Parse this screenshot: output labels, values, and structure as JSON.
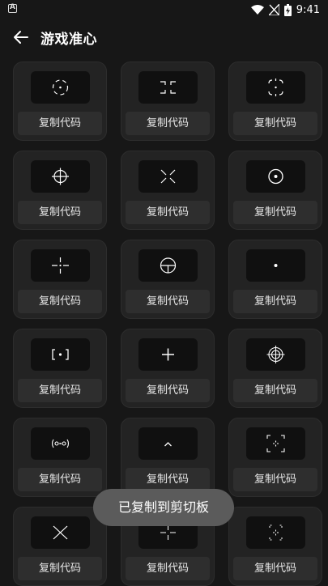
{
  "status_bar": {
    "time": "9:41",
    "notification_icon": "a-icon",
    "icons": [
      "wifi-icon",
      "signal-icon",
      "battery-charging-icon"
    ]
  },
  "app_bar": {
    "title": "游戏准心",
    "back_icon": "arrow-left-icon"
  },
  "crosshairs": [
    {
      "icon": "crosshair-dotted-ring-icon",
      "button_label": "复制代码"
    },
    {
      "icon": "crosshair-corners-inward-icon",
      "button_label": "复制代码"
    },
    {
      "icon": "crosshair-brackets-ring-icon",
      "button_label": "复制代码"
    },
    {
      "icon": "crosshair-scope-ring-icon",
      "button_label": "复制代码"
    },
    {
      "icon": "crosshair-x-gap-icon",
      "button_label": "复制代码"
    },
    {
      "icon": "crosshair-circle-dot-icon",
      "button_label": "复制代码"
    },
    {
      "icon": "crosshair-plus-gap-dot-icon",
      "button_label": "复制代码"
    },
    {
      "icon": "crosshair-circle-t-icon",
      "button_label": "复制代码"
    },
    {
      "icon": "crosshair-single-dot-icon",
      "button_label": "复制代码"
    },
    {
      "icon": "crosshair-brackets-dot-icon",
      "button_label": "复制代码"
    },
    {
      "icon": "crosshair-plus-icon",
      "button_label": "复制代码"
    },
    {
      "icon": "crosshair-target-circle-icon",
      "button_label": "复制代码"
    },
    {
      "icon": "crosshair-ornate-icon",
      "button_label": "复制代码"
    },
    {
      "icon": "crosshair-chevron-icon",
      "button_label": "复制代码"
    },
    {
      "icon": "crosshair-square-corners-icon",
      "button_label": "复制代码"
    },
    {
      "icon": "crosshair-x-icon",
      "button_label": "复制代码"
    },
    {
      "icon": "crosshair-thin-plus-icon",
      "button_label": "复制代码"
    },
    {
      "icon": "crosshair-dotted-corners-icon",
      "button_label": "复制代码"
    }
  ],
  "toast": {
    "text": "已复制到剪切板"
  }
}
